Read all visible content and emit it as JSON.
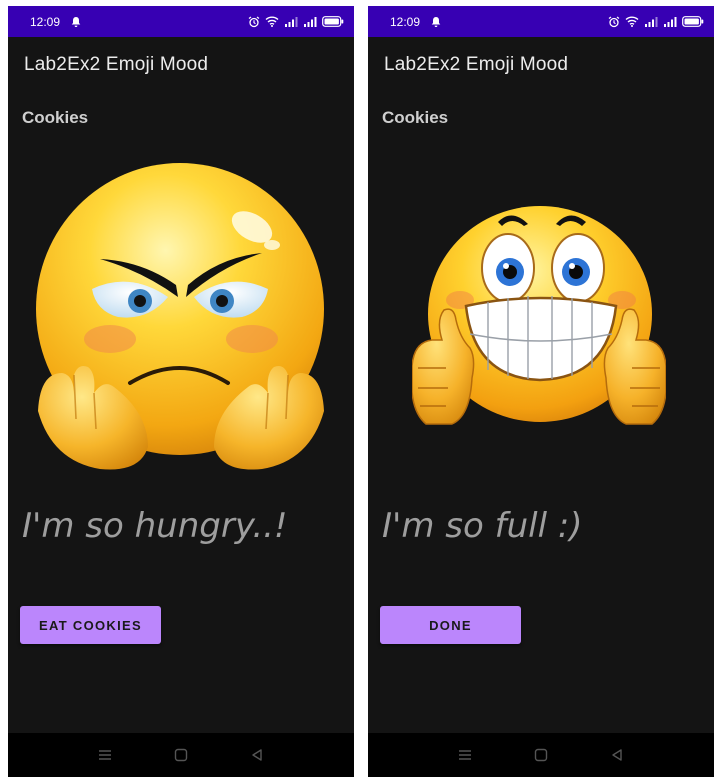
{
  "colors": {
    "status_bar": "#3700b3",
    "background": "#141414",
    "button": "#bb86fc",
    "mood_text": "#9e9e9e",
    "nav_bar": "#000000"
  },
  "screens": [
    {
      "status_time": "12:09",
      "app_title": "Lab2Ex2 Emoji Mood",
      "subtitle": "Cookies",
      "emoji": "angry-hungry-emoji",
      "mood_text": "I'm so hungry..!",
      "button_label": "EAT COOKIES"
    },
    {
      "status_time": "12:09",
      "app_title": "Lab2Ex2 Emoji Mood",
      "subtitle": "Cookies",
      "emoji": "happy-thumbs-up-emoji",
      "mood_text": "I'm so full :)",
      "button_label": "DONE"
    }
  ],
  "icons": {
    "status_left": "notification-bell-icon",
    "status_right": [
      "alarm-icon",
      "wifi-icon",
      "signal-icon",
      "signal-icon",
      "battery-icon"
    ],
    "nav": [
      "menu-icon",
      "home-icon",
      "back-icon"
    ]
  }
}
